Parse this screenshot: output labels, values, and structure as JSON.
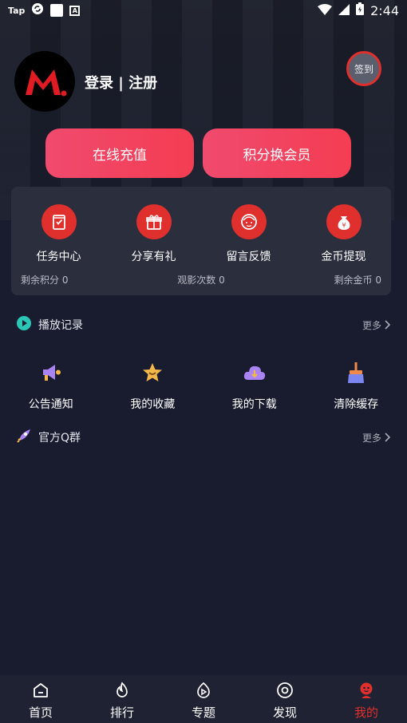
{
  "status_bar": {
    "left_text": "Tap",
    "a_badge": "A",
    "time": "2:44"
  },
  "profile": {
    "logo_letter": "M",
    "login_text": "登录 | 注册",
    "checkin_label": "签到"
  },
  "actions": {
    "recharge": "在线充值",
    "redeem_vip": "积分换会员"
  },
  "menu": [
    {
      "label": "任务中心",
      "icon": "task-icon"
    },
    {
      "label": "分享有礼",
      "icon": "gift-icon"
    },
    {
      "label": "留言反馈",
      "icon": "feedback-icon"
    },
    {
      "label": "金币提现",
      "icon": "moneybag-icon"
    }
  ],
  "stats": {
    "points": "剩余积分 0",
    "views": "观影次数 0",
    "coins": "剩余金币 0"
  },
  "history": {
    "title": "播放记录",
    "more": "更多"
  },
  "tools": [
    {
      "label": "公告通知",
      "icon": "megaphone-icon"
    },
    {
      "label": "我的收藏",
      "icon": "star-icon"
    },
    {
      "label": "我的下载",
      "icon": "cloud-download-icon"
    },
    {
      "label": "清除缓存",
      "icon": "broom-icon"
    }
  ],
  "qq_group": {
    "title": "官方Q群",
    "more": "更多"
  },
  "tabs": [
    {
      "label": "首页",
      "icon": "home-icon"
    },
    {
      "label": "排行",
      "icon": "flame-icon"
    },
    {
      "label": "专题",
      "icon": "play-topic-icon"
    },
    {
      "label": "发现",
      "icon": "discover-icon"
    },
    {
      "label": "我的",
      "icon": "profile-icon",
      "active": true
    }
  ],
  "colors": {
    "accent": "#e0302d",
    "button_gradient_start": "#f04a6e",
    "button_gradient_end": "#f43d52",
    "background": "#181c2e",
    "card": "#2b2e3d"
  }
}
